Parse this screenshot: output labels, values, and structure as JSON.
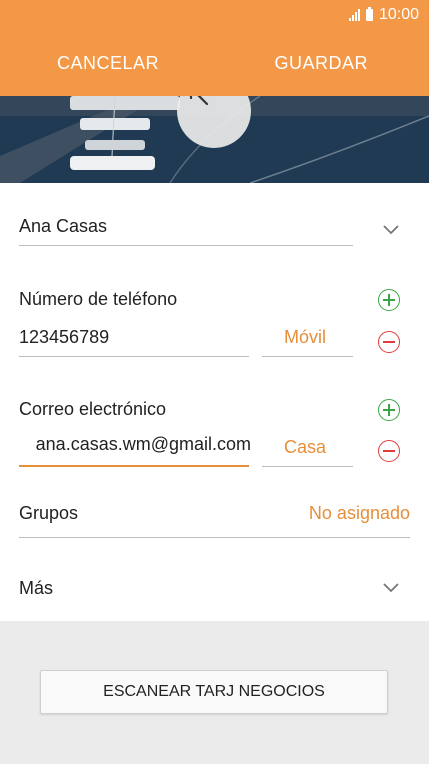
{
  "status_bar": {
    "time": "10:00"
  },
  "action_bar": {
    "cancel_label": "CANCELAR",
    "save_label": "GUARDAR"
  },
  "contact": {
    "name": "Ana Casas",
    "phone": {
      "section_label": "Número de teléfono",
      "value": "123456789",
      "type": "Móvil"
    },
    "email": {
      "section_label": "Correo electrónico",
      "value": "ana.casas.wm@gmail.com",
      "type": "Casa"
    },
    "groups": {
      "label": "Grupos",
      "value": "No asignado"
    },
    "more": {
      "label": "Más"
    }
  },
  "scan_button_label": "ESCANEAR TARJ NEGOCIOS",
  "colors": {
    "accent": "#f39847",
    "accent_text": "#e58f3b",
    "add": "#3aa547",
    "remove": "#dd3d3d"
  },
  "icons": {
    "photo": "magic-wand-icon",
    "expand": "chevron-down-icon",
    "add": "plus-circle-icon",
    "remove": "minus-circle-icon"
  }
}
